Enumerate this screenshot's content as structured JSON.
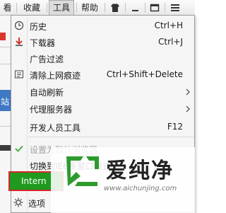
{
  "menubar": {
    "items": [
      {
        "label": "看"
      },
      {
        "label": "收藏"
      },
      {
        "label": "工具"
      },
      {
        "label": "帮助"
      }
    ],
    "toolbar_icons": [
      "shirt-icon",
      "window-icon",
      "menu-icon"
    ]
  },
  "background": {
    "blue_text": "站"
  },
  "menu": {
    "items": [
      {
        "label": "历史",
        "shortcut": "Ctrl+H",
        "icon": "clock-icon"
      },
      {
        "label": "下载器",
        "shortcut": "Ctrl+J",
        "icon": "download-icon"
      },
      {
        "label": "广告过滤",
        "shortcut": ""
      },
      {
        "label": "清除上网痕迹",
        "shortcut": "Ctrl+Shift+Delete",
        "icon": "eraser-icon"
      },
      {
        "label": "自动刷新",
        "submenu": true
      },
      {
        "label": "代理服务器",
        "submenu": true
      },
      {
        "label": "开发人员工具",
        "shortcut": "F12"
      },
      {
        "label": "设置为默认浏览器",
        "disabled": true,
        "checked": true
      },
      {
        "label": "切换到IE6多窗口模式"
      },
      {
        "label": "Intern"
      },
      {
        "label": "选项",
        "icon": "gear-icon"
      }
    ]
  },
  "watermark": {
    "name": "爱纯净",
    "url": "www.aichunjing.com"
  },
  "colors": {
    "green_item": "#1f9a1f",
    "red_border": "#d4262a",
    "check_green": "#3aa83a",
    "logo_green": "#2e9b2e"
  }
}
